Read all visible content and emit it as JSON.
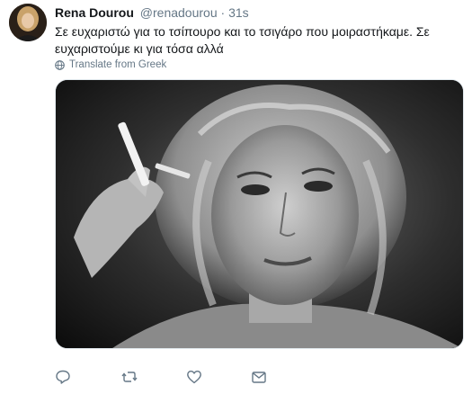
{
  "author": {
    "display_name": "Rena Dourou",
    "handle": "@renadourou",
    "separator": "·",
    "timestamp": "31s"
  },
  "tweet": {
    "text": "Σε ευχαριστώ για το τσίπουρο και το τσιγάρο που μοιραστήκαμε. Σε ευχαριστούμε κι για τόσα αλλά",
    "translate_label": "Translate from Greek"
  },
  "icons": {
    "globe": "globe-icon",
    "reply": "reply-icon",
    "retweet": "retweet-icon",
    "like": "heart-icon",
    "message": "envelope-icon"
  },
  "colors": {
    "text_primary": "#14171a",
    "text_secondary": "#657786",
    "action_icon": "#657786"
  }
}
